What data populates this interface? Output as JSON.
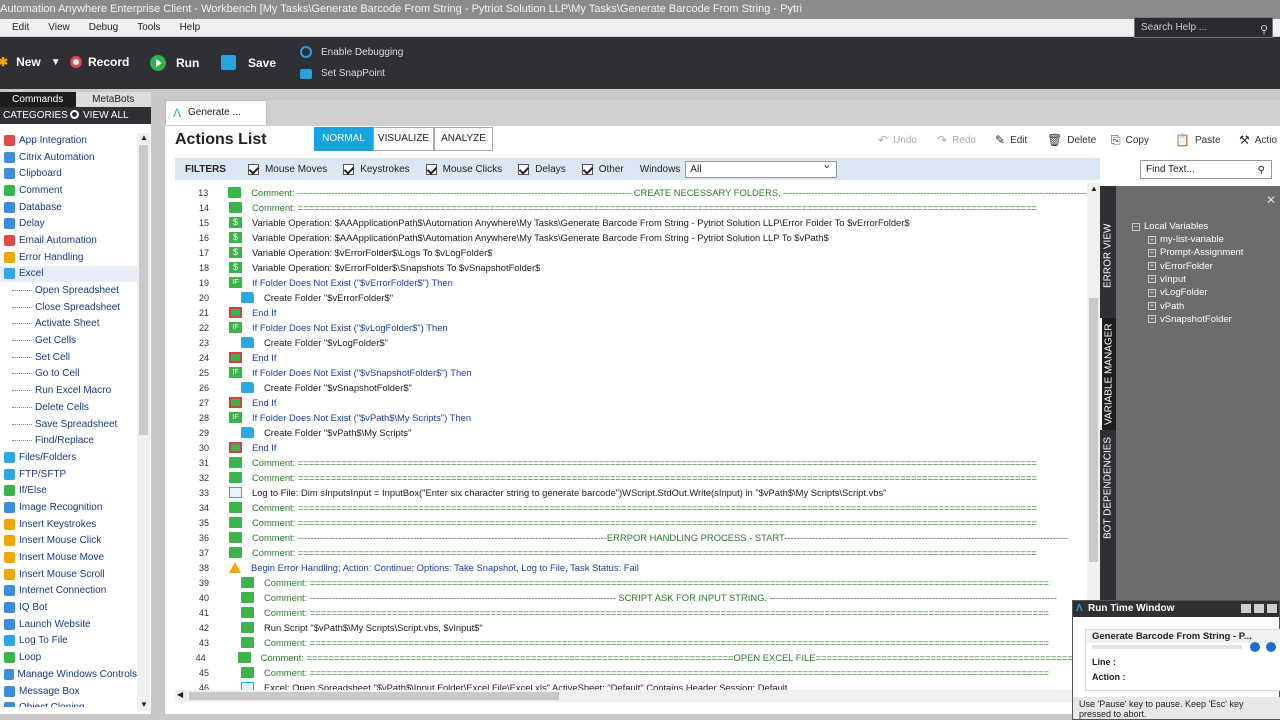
{
  "window": {
    "title": "Automation Anywhere Enterprise Client - Workbench [My Tasks\\Generate Barcode From String -  Pytriot Solution LLP\\My Tasks\\Generate Barcode From String -  Pytri"
  },
  "menu": [
    "Edit",
    "View",
    "Debug",
    "Tools",
    "Help"
  ],
  "toolbar": {
    "new_label": "New",
    "record_label": "Record",
    "run_label": "Run",
    "save_label": "Save",
    "enable_debugging": "Enable Debugging",
    "set_snappoint": "Set SnapPoint",
    "search_placeholder": "Search Help ..."
  },
  "left_panel": {
    "tabs": [
      "Commands",
      "MetaBots"
    ],
    "categories_label": "CATEGORIES",
    "view_all_label": "VIEW ALL",
    "items": [
      {
        "label": "App Integration",
        "color": "#e04a4a",
        "sub": false
      },
      {
        "label": "Citrix Automation",
        "color": "#3c8edc",
        "sub": false
      },
      {
        "label": "Clipboard",
        "color": "#3c8edc",
        "sub": false
      },
      {
        "label": "Comment",
        "color": "#3bb44a",
        "sub": false
      },
      {
        "label": "Database",
        "color": "#3c8edc",
        "sub": false
      },
      {
        "label": "Delay",
        "color": "#3c8edc",
        "sub": false
      },
      {
        "label": "Email Automation",
        "color": "#e04a4a",
        "sub": false
      },
      {
        "label": "Error Handling",
        "color": "#f0a800",
        "sub": false
      },
      {
        "label": "Excel",
        "color": "#2da8e6",
        "sub": false,
        "selected": true
      },
      {
        "label": "Open Spreadsheet",
        "sub": true
      },
      {
        "label": "Close Spreadsheet",
        "sub": true
      },
      {
        "label": "Activate Sheet",
        "sub": true
      },
      {
        "label": "Get Cells",
        "sub": true
      },
      {
        "label": "Set Cell",
        "sub": true
      },
      {
        "label": "Go to Cell",
        "sub": true
      },
      {
        "label": "Run Excel Macro",
        "sub": true
      },
      {
        "label": "Delete Cells",
        "sub": true
      },
      {
        "label": "Save Spreadsheet",
        "sub": true
      },
      {
        "label": "Find/Replace",
        "sub": true
      },
      {
        "label": "Files/Folders",
        "color": "#2da8e6",
        "sub": false
      },
      {
        "label": "FTP/SFTP",
        "color": "#2da8e6",
        "sub": false
      },
      {
        "label": "If/Else",
        "color": "#3bb44a",
        "sub": false
      },
      {
        "label": "Image Recognition",
        "color": "#3c8edc",
        "sub": false
      },
      {
        "label": "Insert Keystrokes",
        "color": "#f0a800",
        "sub": false
      },
      {
        "label": "Insert Mouse Click",
        "color": "#f0a800",
        "sub": false
      },
      {
        "label": "Insert Mouse Move",
        "color": "#f0a800",
        "sub": false
      },
      {
        "label": "Insert Mouse Scroll",
        "color": "#f0a800",
        "sub": false
      },
      {
        "label": "Internet Connection",
        "color": "#3c8edc",
        "sub": false
      },
      {
        "label": "IQ Bot",
        "color": "#3c8edc",
        "sub": false
      },
      {
        "label": "Launch Website",
        "color": "#3c8edc",
        "sub": false
      },
      {
        "label": "Log To File",
        "color": "#2da8e6",
        "sub": false
      },
      {
        "label": "Loop",
        "color": "#3bb44a",
        "sub": false
      },
      {
        "label": "Manage Windows Controls",
        "color": "#3c8edc",
        "sub": false
      },
      {
        "label": "Message Box",
        "color": "#3c8edc",
        "sub": false
      },
      {
        "label": "Object Cloning",
        "color": "#3c8edc",
        "sub": false
      }
    ]
  },
  "doc_tab": "Generate ...",
  "actions": {
    "title": "Actions List",
    "modes": [
      "NORMAL",
      "VISUALIZE",
      "ANALYZE"
    ],
    "tools": {
      "undo": "Undo",
      "redo": "Redo",
      "edit": "Edit",
      "delete": "Delete",
      "copy": "Copy",
      "paste": "Paste",
      "action": "Actio"
    },
    "filters_label": "FILTERS",
    "filters": [
      "Mouse Moves",
      "Keystrokes",
      "Mouse Clicks",
      "Delays",
      "Other"
    ],
    "windows_label": "Windows",
    "windows_value": "All",
    "find_placeholder": "Find Text..."
  },
  "rows": [
    {
      "n": "13",
      "type": "com",
      "indent": 0,
      "text": "Comment: ----------------------------------------------------------------------------------------------------------- CREATE NECESSARY FOLDERS. -------------------------------------------------------------------------------------------------------"
    },
    {
      "n": "14",
      "type": "com",
      "indent": 0,
      "text": "Comment: ======================================================================================================================================="
    },
    {
      "n": "15",
      "type": "var",
      "indent": 0,
      "text": "Variable Operation: $AAApplicationPath$\\Automation Anywhere\\My Tasks\\Generate Barcode From String -  Pytriot Solution LLP\\Error Folder To $vErrorFolder$"
    },
    {
      "n": "16",
      "type": "var",
      "indent": 0,
      "text": "Variable Operation: $AAApplicationPath$\\Automation Anywhere\\My Tasks\\Generate Barcode From String -  Pytriot Solution LLP To $vPath$"
    },
    {
      "n": "17",
      "type": "var",
      "indent": 0,
      "text": "Variable Operation: $vErrorFolder$\\Logs To $vLogFolder$"
    },
    {
      "n": "18",
      "type": "var",
      "indent": 0,
      "text": "Variable Operation: $vErrorFolder$\\Snapshots To $vSnapshotFolder$"
    },
    {
      "n": "19",
      "type": "if",
      "indent": 0,
      "text": "If Folder Does Not Exist (\"$vErrorFolder$\")  Then"
    },
    {
      "n": "20",
      "type": "fold",
      "indent": 1,
      "text": "Create Folder \"$vErrorFolder$\""
    },
    {
      "n": "21",
      "type": "end",
      "indent": 0,
      "text": "End If"
    },
    {
      "n": "22",
      "type": "if",
      "indent": 0,
      "text": "If Folder Does Not Exist (\"$vLogFolder$\")  Then"
    },
    {
      "n": "23",
      "type": "fold",
      "indent": 1,
      "text": "Create Folder \"$vLogFolder$\""
    },
    {
      "n": "24",
      "type": "end",
      "indent": 0,
      "text": "End If"
    },
    {
      "n": "25",
      "type": "if",
      "indent": 0,
      "text": "If Folder Does Not Exist (\"$vSnapshotFolder$\")  Then"
    },
    {
      "n": "26",
      "type": "fold",
      "indent": 1,
      "text": "Create Folder \"$vSnapshotFolder$\""
    },
    {
      "n": "27",
      "type": "end",
      "indent": 0,
      "text": "End If"
    },
    {
      "n": "28",
      "type": "if",
      "indent": 0,
      "text": "If Folder Does Not Exist (\"$vPath$\\My Scripts\")  Then"
    },
    {
      "n": "29",
      "type": "fold",
      "indent": 1,
      "text": "Create Folder \"$vPath$\\My Scripts\""
    },
    {
      "n": "30",
      "type": "end",
      "indent": 0,
      "text": "End If"
    },
    {
      "n": "31",
      "type": "com",
      "indent": 0,
      "text": "Comment: ======================================================================================================================================="
    },
    {
      "n": "32",
      "type": "com",
      "indent": 0,
      "text": "Comment: ======================================================================================================================================="
    },
    {
      "n": "33",
      "type": "log",
      "indent": 0,
      "text": "Log to File: Dim sInputsInput = InputBox(\"Enter six character string to generate barcode\")WScript.StdOut.Write(sInput) in \"$vPath$\\My Scripts\\Script.vbs\""
    },
    {
      "n": "34",
      "type": "com",
      "indent": 0,
      "text": "Comment: ======================================================================================================================================="
    },
    {
      "n": "35",
      "type": "com",
      "indent": 0,
      "text": "Comment: ======================================================================================================================================="
    },
    {
      "n": "36",
      "type": "com",
      "indent": 0,
      "text": "Comment: ---------------------------------------------------------------------------------------------------ERRPOR HANDLING PROCESS - START-------------------------------------------------------------------------------------------"
    },
    {
      "n": "37",
      "type": "com",
      "indent": 0,
      "text": "Comment: ======================================================================================================================================="
    },
    {
      "n": "38",
      "type": "warn",
      "indent": 0,
      "text": "Begin Error Handling; Action: Continue; Options: Take Snapshot, Log to File,  Task Status: Fail"
    },
    {
      "n": "39",
      "type": "com",
      "indent": 1,
      "text": "Comment: ======================================================================================================================================="
    },
    {
      "n": "40",
      "type": "com",
      "indent": 1,
      "text": "Comment: -------------------------------------------------------------------------------------------------- SCRIPT ASK FOR INPUT STRING. --------------------------------------------------------------------------------------------"
    },
    {
      "n": "41",
      "type": "com",
      "indent": 1,
      "text": "Comment: ======================================================================================================================================="
    },
    {
      "n": "42",
      "type": "run",
      "indent": 1,
      "text": "Run Script \"$vPath$\\My Scripts\\Script.vbs, $vInput$\""
    },
    {
      "n": "43",
      "type": "com",
      "indent": 1,
      "text": "Comment: ======================================================================================================================================="
    },
    {
      "n": "44",
      "type": "com",
      "indent": 1,
      "text": "Comment: ==============================================================================OPEN EXCEL FILE=================================================================="
    },
    {
      "n": "45",
      "type": "com",
      "indent": 1,
      "text": "Comment: ======================================================================================================================================="
    },
    {
      "n": "46",
      "type": "xl",
      "indent": 1,
      "text": "Excel: Open Spreadsheet \"$vPath$\\Input Folder\\Excel File\\Excel.xls\"  ActiveSheet: \"Default\"  Contains Header  Session: Default"
    }
  ],
  "side_tabs": [
    "ERROR VIEW",
    "VARIABLE MANAGER",
    "BOT DEPENDENCIES"
  ],
  "variables": {
    "root": "Local Variables",
    "items": [
      "my-list-variable",
      "Prompt-Assignment",
      "vErrorFolder",
      "vInput",
      "vLogFolder",
      "vPath",
      "vSnapshotFolder"
    ]
  },
  "runtime": {
    "title": "Run Time Window",
    "task": "Generate Barcode From String -  P...",
    "line_label": "Line :",
    "action_label": "Action :",
    "footer": "Use 'Pause' key to pause. Keep 'Esc' key pressed to abort."
  }
}
